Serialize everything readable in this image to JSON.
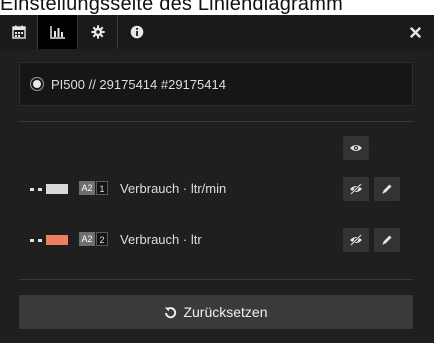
{
  "caption": "Einstellungsseite des Liniendiagramm",
  "tabs": [
    {
      "icon": "calendar-icon"
    },
    {
      "icon": "bar-chart-icon"
    },
    {
      "icon": "gear-icon"
    },
    {
      "icon": "info-icon"
    }
  ],
  "source": {
    "label": "PI500 // 29175414 #29175414"
  },
  "series": [
    {
      "color": "#d9d9d9",
      "axis": "A2",
      "number": "1",
      "label": "Verbrauch · ltr/min"
    },
    {
      "color": "#f07e5e",
      "axis": "A2",
      "number": "2",
      "label": "Verbrauch · ltr"
    }
  ],
  "reset_label": "Zurücksetzen"
}
